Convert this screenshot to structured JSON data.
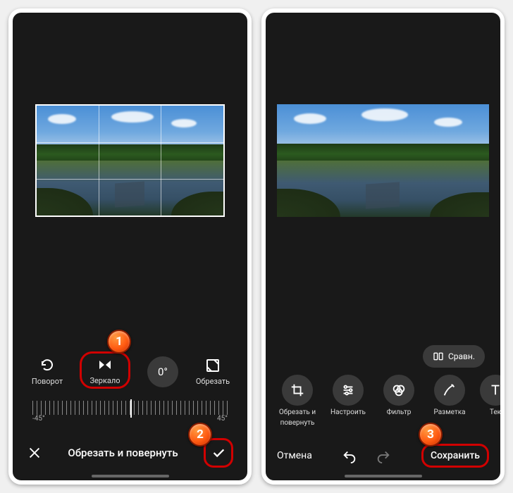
{
  "callouts": {
    "c1": "1",
    "c2": "2",
    "c3": "3"
  },
  "phone1": {
    "tools": {
      "rotate": "Поворот",
      "mirror": "Зеркало",
      "angle_value": "0°",
      "crop": "Обрезать"
    },
    "ruler": {
      "min": "-45°",
      "max": "45°"
    },
    "bottom_title": "Обрезать и повернуть"
  },
  "phone2": {
    "compare_label": "Сравн.",
    "tools": {
      "crop_rotate_line1": "Обрезать и",
      "crop_rotate_line2": "повернуть",
      "adjust": "Настроить",
      "filter": "Фильтр",
      "markup": "Разметка",
      "text": "Тек"
    },
    "cancel": "Отмена",
    "save": "Сохранить"
  }
}
